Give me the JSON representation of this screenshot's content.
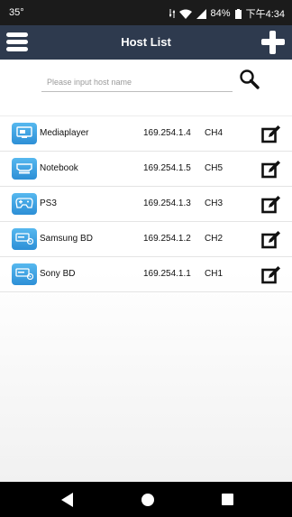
{
  "status_bar": {
    "left_text": "35°",
    "battery": "84%",
    "time": "下午4:34"
  },
  "app_bar": {
    "title": "Host List",
    "menu_icon": "hamburger-menu-icon",
    "add_icon": "plus-icon"
  },
  "search": {
    "placeholder": "Please input host name",
    "value": "",
    "icon": "search-icon"
  },
  "hosts": [
    {
      "name": "Mediaplayer",
      "ip": "169.254.1.4",
      "channel": "CH4",
      "icon": "mediaplayer-icon"
    },
    {
      "name": "Notebook",
      "ip": "169.254.1.5",
      "channel": "CH5",
      "icon": "hdmi-notebook-icon"
    },
    {
      "name": "PS3",
      "ip": "169.254.1.3",
      "channel": "CH3",
      "icon": "gamepad-icon"
    },
    {
      "name": "Samsung BD",
      "ip": "169.254.1.2",
      "channel": "CH2",
      "icon": "bluray-player-icon"
    },
    {
      "name": "Sony BD",
      "ip": "169.254.1.1",
      "channel": "CH1",
      "icon": "bluray-player-icon"
    }
  ],
  "colors": {
    "app_bar": "#2e3a4e",
    "status_bar": "#1b1b1b",
    "device_icon": "#3a9fe3",
    "nav_bar": "#000000"
  }
}
